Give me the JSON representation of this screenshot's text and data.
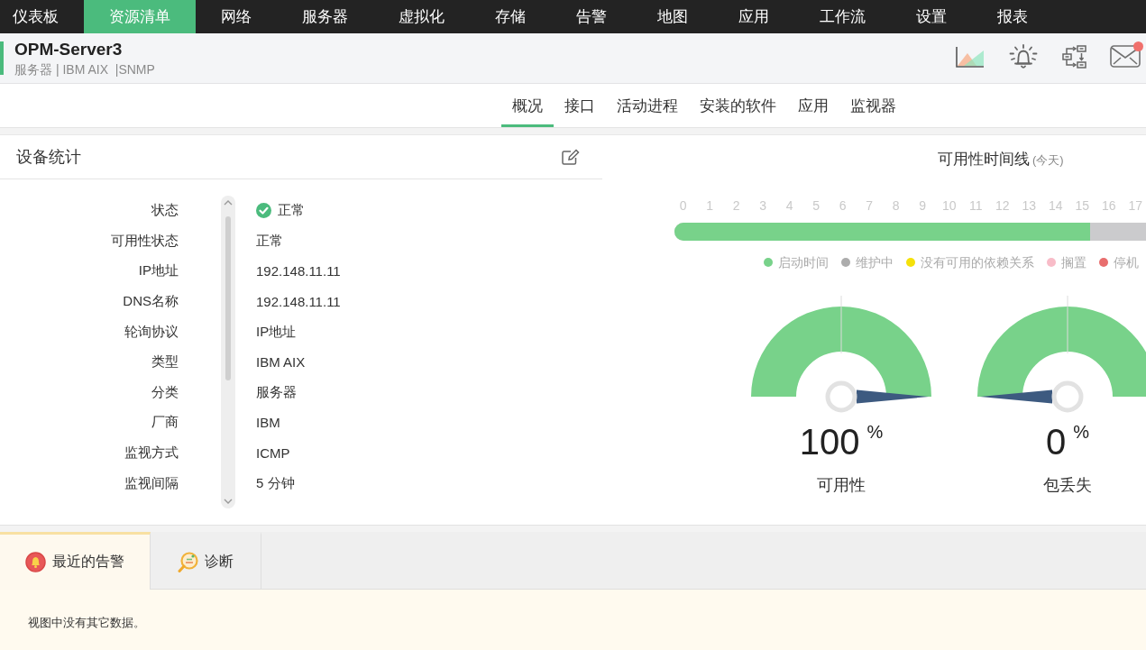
{
  "top_nav": {
    "items": [
      {
        "label": "仪表板",
        "selected": false
      },
      {
        "label": "资源清单",
        "selected": true
      },
      {
        "label": "网络",
        "selected": false
      },
      {
        "label": "服务器",
        "selected": false
      },
      {
        "label": "虚拟化",
        "selected": false
      },
      {
        "label": "存储",
        "selected": false
      },
      {
        "label": "告警",
        "selected": false
      },
      {
        "label": "地图",
        "selected": false
      },
      {
        "label": "应用",
        "selected": false
      },
      {
        "label": "工作流",
        "selected": false
      },
      {
        "label": "设置",
        "selected": false
      },
      {
        "label": "报表",
        "selected": false
      }
    ]
  },
  "header": {
    "title": "OPM-Server3",
    "subtitle": "服务器 | IBM AIX  |SNMP",
    "mail_badge": true
  },
  "sub_tabs": [
    {
      "label": "概况",
      "selected": true
    },
    {
      "label": "接口",
      "selected": false
    },
    {
      "label": "活动进程",
      "selected": false
    },
    {
      "label": "安装的软件",
      "selected": false
    },
    {
      "label": "应用",
      "selected": false
    },
    {
      "label": "监视器",
      "selected": false
    }
  ],
  "device_stats": {
    "title": "设备统计",
    "rows": [
      {
        "label": "状态",
        "value": "正常",
        "kind": "status"
      },
      {
        "label": "可用性状态",
        "value": "正常",
        "kind": "text"
      },
      {
        "label": "IP地址",
        "value": "192.148.11.11",
        "kind": "text"
      },
      {
        "label": "DNS名称",
        "value": "192.148.11.11",
        "kind": "text"
      },
      {
        "label": "轮询协议",
        "value": "IP地址",
        "kind": "text"
      },
      {
        "label": "类型",
        "value": "IBM AIX",
        "kind": "text"
      },
      {
        "label": "分类",
        "value": "服务器",
        "kind": "text"
      },
      {
        "label": "厂商",
        "value": "IBM",
        "kind": "text"
      },
      {
        "label": "监视方式",
        "value": "ICMP",
        "kind": "text"
      },
      {
        "label": "监视间隔",
        "value": "5 分钟",
        "kind": "text"
      }
    ]
  },
  "availability_timeline": {
    "title": "可用性时间线",
    "period": "(今天)",
    "hours": [
      "0",
      "1",
      "2",
      "3",
      "4",
      "5",
      "6",
      "7",
      "8",
      "9",
      "10",
      "11",
      "12",
      "13",
      "14",
      "15",
      "16",
      "17"
    ],
    "level": 0.64,
    "legend": [
      {
        "label": "启动时间",
        "color": "#78d28a"
      },
      {
        "label": "维护中",
        "color": "#acacac"
      },
      {
        "label": "没有可用的依赖关系",
        "color": "#f5e10a"
      },
      {
        "label": "搁置",
        "color": "#f8bcc8"
      },
      {
        "label": "停机",
        "color": "#e86e6e"
      }
    ]
  },
  "gauges": [
    {
      "value": "100",
      "unit": "%",
      "label": "可用性"
    },
    {
      "value": "0",
      "unit": "%",
      "label": "包丢失"
    }
  ],
  "bottom_tabs": [
    {
      "label": "最近的告警",
      "selected": true,
      "kind": "alerts"
    },
    {
      "label": "诊断",
      "selected": false,
      "kind": "diagnosis"
    }
  ],
  "bottom_panel": {
    "message": "视图中没有其它数据。"
  }
}
